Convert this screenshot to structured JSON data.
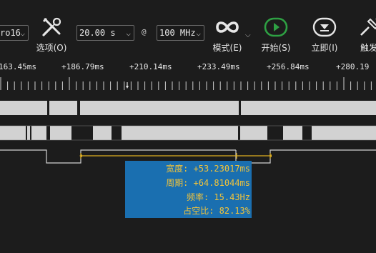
{
  "toolbar": {
    "channel_combo": "ro16",
    "options_label": "选项(O)",
    "timebase_value": "20.00 s",
    "at_symbol": "@",
    "samplerate_value": "100 MHz",
    "mode_label": "模式(E)",
    "start_label": "开始(S)",
    "instant_label": "立即(I)",
    "trigger_label": "触发",
    "icons": {
      "options": "tools-icon",
      "mode": "infinity-icon",
      "start": "play-icon",
      "instant": "instant-icon",
      "trigger": "trigger-icon"
    }
  },
  "ruler": {
    "tick_labels": [
      "163.45ms",
      "+186.79ms",
      "+210.14ms",
      "+233.49ms",
      "+256.84ms",
      "+280.19"
    ]
  },
  "measurement": {
    "width": "宽度: +53.23017ms",
    "period": "周期: +64.81044ms",
    "frequency": "频率: 15.43Hz",
    "duty": "占空比: 82.13%"
  },
  "colors": {
    "background": "#1c1c1c",
    "signal": "#d2d2d2",
    "cursor": "#e0b020",
    "measure_panel": "#1a6fb0",
    "measure_text": "#f2c33a",
    "start_button": "#2ea043"
  }
}
